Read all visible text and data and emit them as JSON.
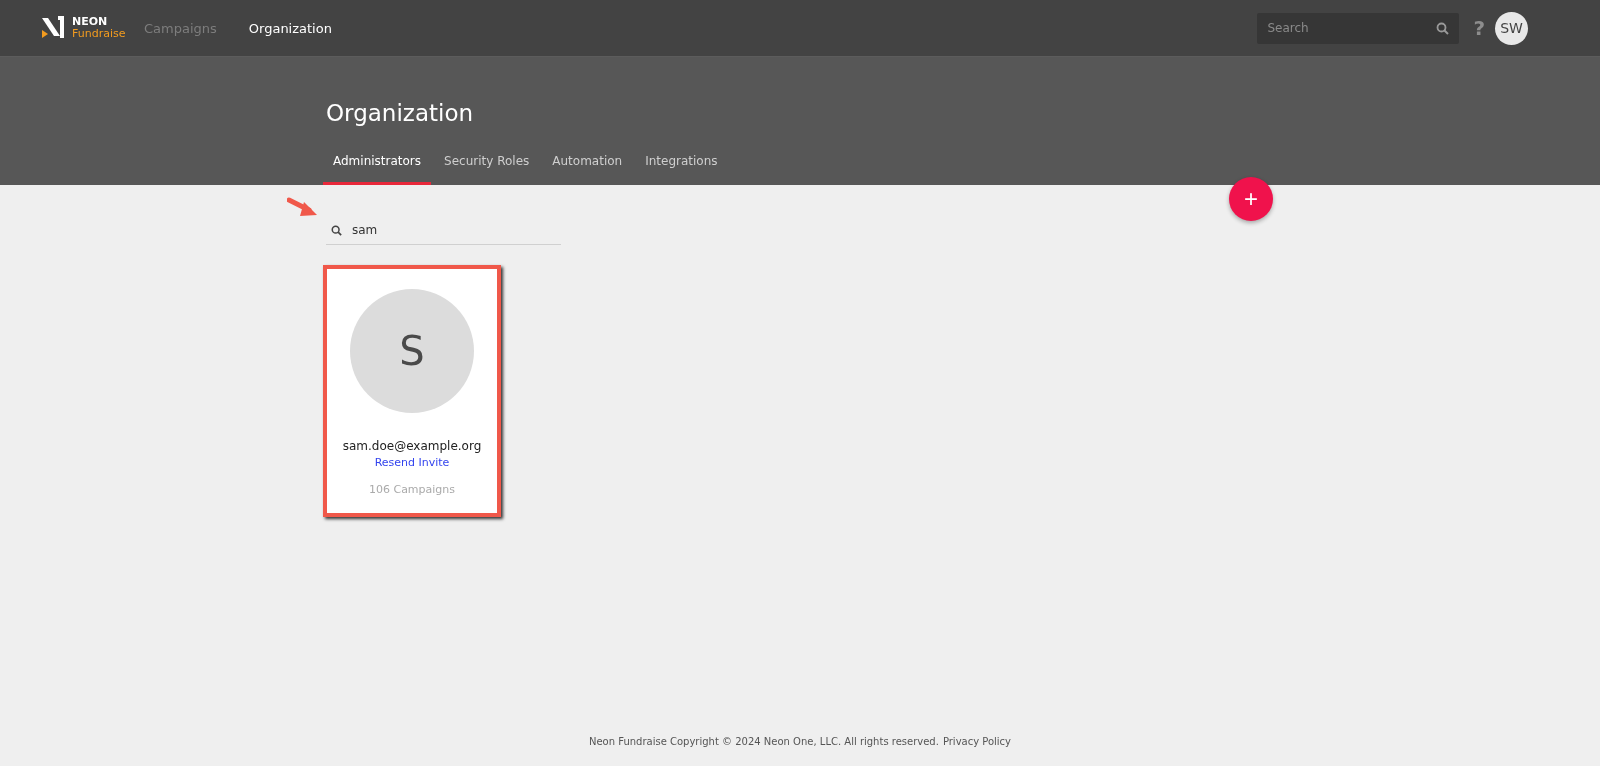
{
  "topbar": {
    "logo": {
      "word1": "NEON",
      "word2": "Fundraise"
    },
    "nav": [
      {
        "label": "Campaigns",
        "selected": false
      },
      {
        "label": "Organization",
        "selected": true
      }
    ],
    "search": {
      "placeholder": "Search"
    },
    "help": "?",
    "avatar": "SW"
  },
  "header": {
    "title": "Organization",
    "tabs": [
      {
        "label": "Administrators",
        "selected": true
      },
      {
        "label": "Security Roles",
        "selected": false
      },
      {
        "label": "Automation",
        "selected": false
      },
      {
        "label": "Integrations",
        "selected": false
      }
    ]
  },
  "add_button": "+",
  "filter": {
    "value": "sam"
  },
  "admins": [
    {
      "initial": "S",
      "email": "sam.doe@example.org",
      "action": "Resend Invite",
      "campaigns": "106 Campaigns",
      "highlighted": true
    }
  ],
  "footer": {
    "text": "Neon Fundraise Copyright © 2024 Neon One, LLC. All rights reserved.",
    "link": "Privacy Policy"
  }
}
